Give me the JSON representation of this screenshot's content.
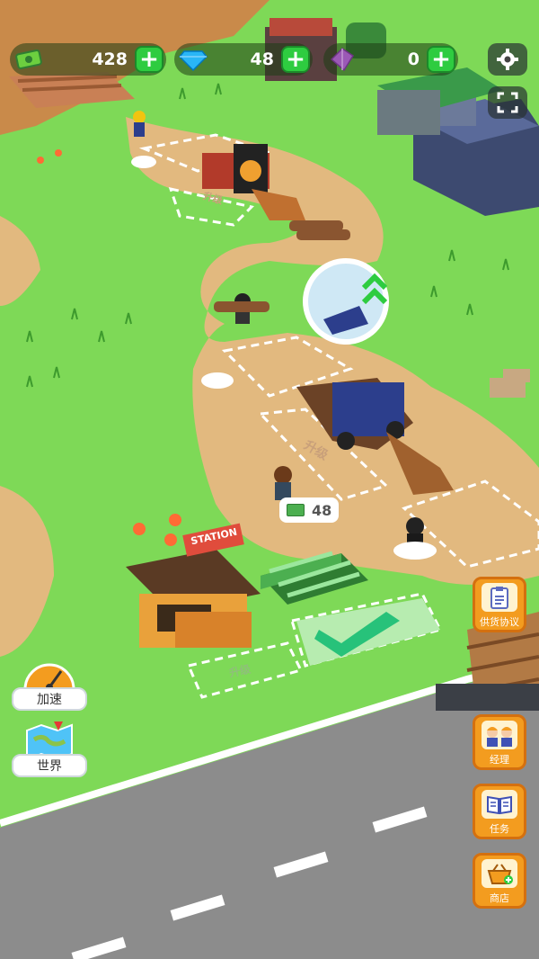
{
  "hud": {
    "cash": "428",
    "gems": "48",
    "crystals": "0"
  },
  "station_sign": "STATION",
  "money_bubble": "48",
  "upgrade_label_a": "升级",
  "upgrade_label_b": "升级",
  "upgrade_label_c": "升级",
  "left_buttons": {
    "speed": "加速",
    "world": "世界"
  },
  "side_buttons": {
    "supply": "供货协议",
    "manager": "经理",
    "tasks": "任务",
    "shop": "商店"
  },
  "colors": {
    "grass": "#7ed957",
    "path": "#e2b97f",
    "road": "#8c8c8c",
    "accent": "#f39c1f",
    "plus": "#2ecc40"
  }
}
